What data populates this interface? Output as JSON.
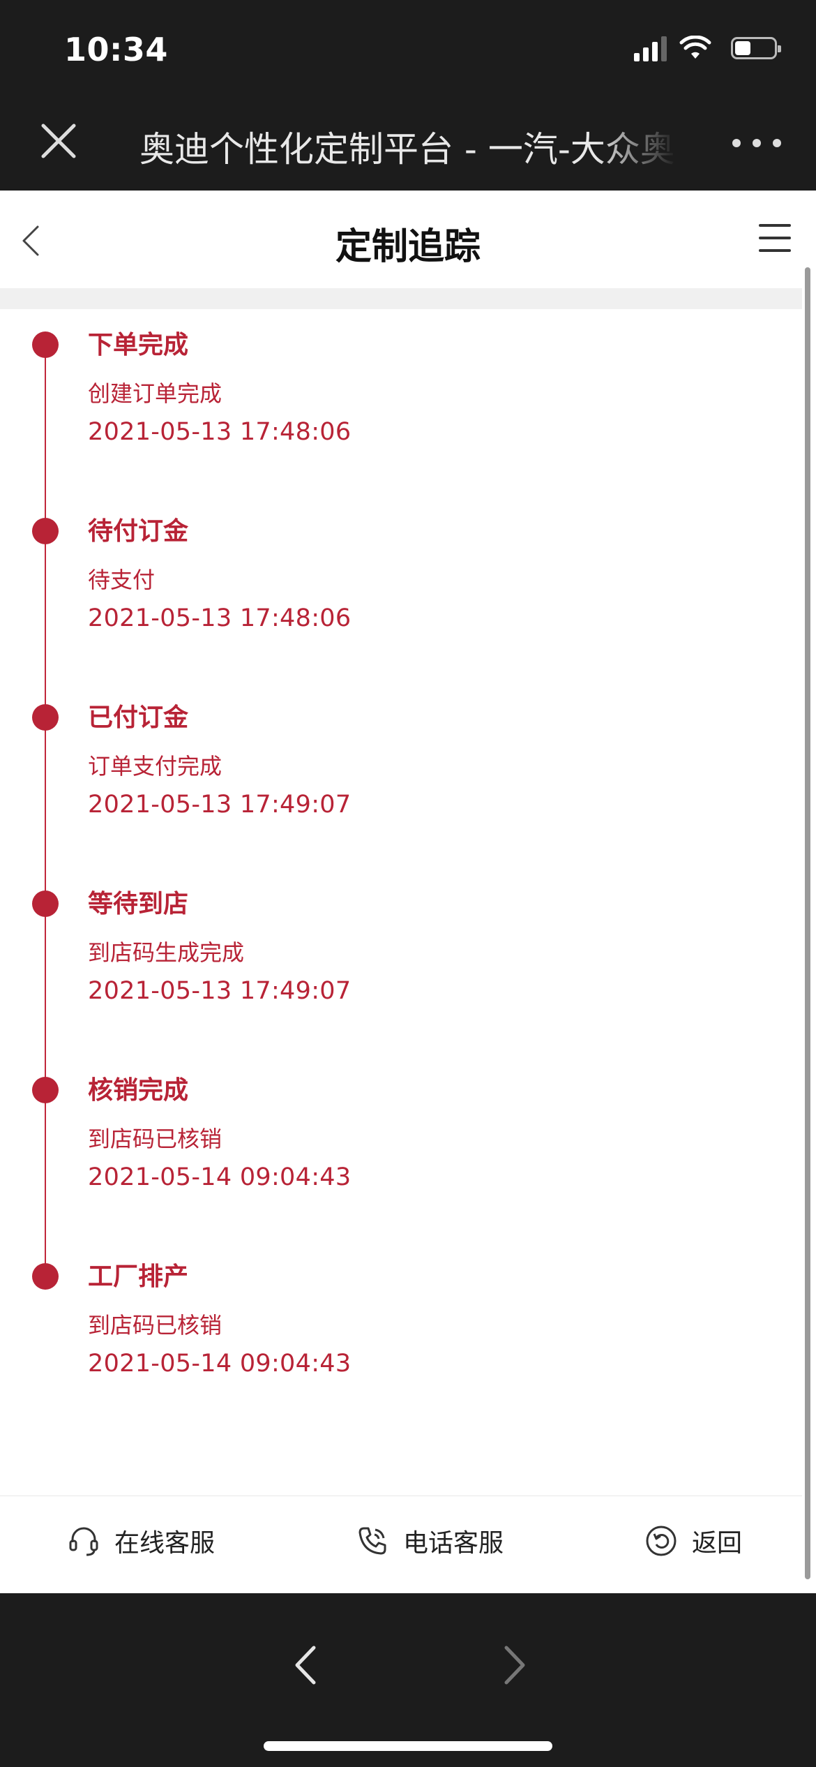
{
  "status_bar": {
    "time": "10:34",
    "battery_level": 0.4
  },
  "browser": {
    "title": "奥迪个性化定制平台 - 一汽-大众奥迪"
  },
  "header": {
    "title": "定制追踪"
  },
  "timeline": [
    {
      "title": "下单完成",
      "desc": "创建订单完成",
      "time": "2021-05-13 17:48:06"
    },
    {
      "title": "待付订金",
      "desc": "待支付",
      "time": "2021-05-13 17:48:06"
    },
    {
      "title": "已付订金",
      "desc": "订单支付完成",
      "time": "2021-05-13 17:49:07"
    },
    {
      "title": "等待到店",
      "desc": "到店码生成完成",
      "time": "2021-05-13 17:49:07"
    },
    {
      "title": "核销完成",
      "desc": "到店码已核销",
      "time": "2021-05-14 09:04:43"
    },
    {
      "title": "工厂排产",
      "desc": "到店码已核销",
      "time": "2021-05-14 09:04:43"
    }
  ],
  "footer": {
    "online_service": "在线客服",
    "phone_service": "电话客服",
    "back": "返回"
  },
  "colors": {
    "accent": "#b82336",
    "dark_bg": "#1c1c1c"
  },
  "icons": {
    "close": "close-icon",
    "more": "more-dots-icon",
    "back": "chevron-left-icon",
    "menu": "hamburger-menu-icon",
    "headset": "headset-icon",
    "phone": "phone-icon",
    "return": "return-icon"
  }
}
